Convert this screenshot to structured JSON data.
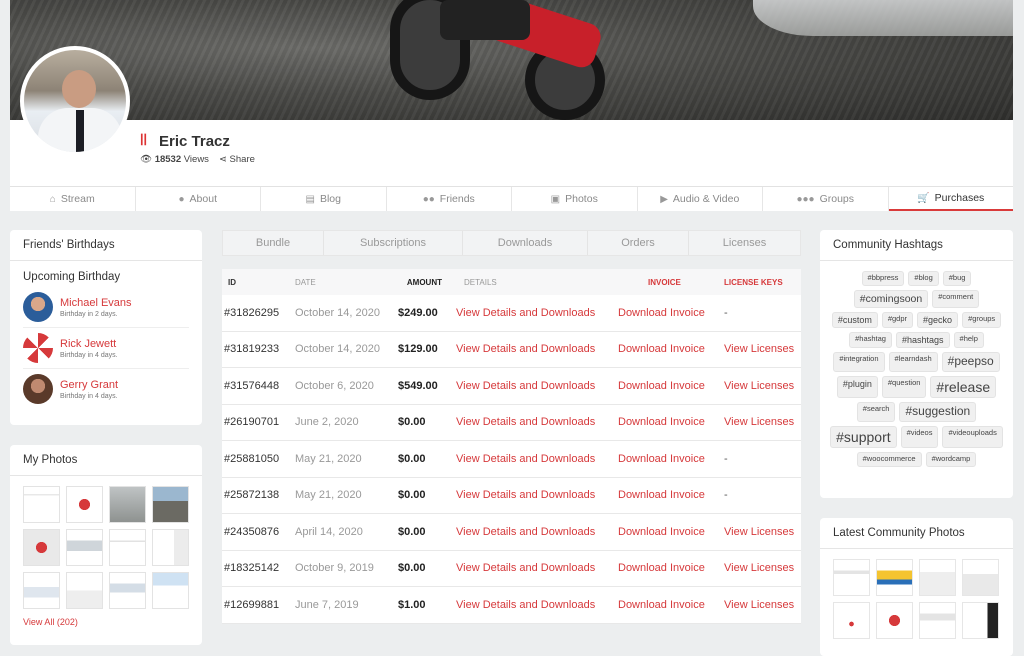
{
  "profile": {
    "name": "Eric Tracz",
    "views_count": "18532",
    "views_label": "Views",
    "share_label": "Share"
  },
  "tabs": [
    {
      "label": "Stream",
      "icon": "home-icon"
    },
    {
      "label": "About",
      "icon": "user-icon"
    },
    {
      "label": "Blog",
      "icon": "blog-icon"
    },
    {
      "label": "Friends",
      "icon": "users-icon"
    },
    {
      "label": "Photos",
      "icon": "camera-icon"
    },
    {
      "label": "Audio & Video",
      "icon": "video-icon"
    },
    {
      "label": "Groups",
      "icon": "groups-icon"
    },
    {
      "label": "Purchases",
      "icon": "cart-icon",
      "active": true
    }
  ],
  "birthdays": {
    "title": "Friends' Birthdays",
    "subtitle": "Upcoming Birthday",
    "items": [
      {
        "name": "Michael Evans",
        "when": "Birthday in 2 days."
      },
      {
        "name": "Rick Jewett",
        "when": "Birthday in 4 days."
      },
      {
        "name": "Gerry Grant",
        "when": "Birthday in 4 days."
      }
    ]
  },
  "photos": {
    "title": "My Photos",
    "view_all": "View All (202)"
  },
  "purchases": {
    "subtabs": [
      "Bundle",
      "Subscriptions",
      "Downloads",
      "Orders",
      "Licenses"
    ],
    "columns": [
      "ID",
      "DATE",
      "AMOUNT",
      "DETAILS",
      "INVOICE",
      "LICENSE KEYS"
    ],
    "rows": [
      {
        "id": "#31826295",
        "date": "October 14, 2020",
        "amount": "$249.00",
        "details": "View Details and Downloads",
        "invoice": "Download Invoice",
        "license": "-"
      },
      {
        "id": "#31819233",
        "date": "October 14, 2020",
        "amount": "$129.00",
        "details": "View Details and Downloads",
        "invoice": "Download Invoice",
        "license": "View Licenses"
      },
      {
        "id": "#31576448",
        "date": "October 6, 2020",
        "amount": "$549.00",
        "details": "View Details and Downloads",
        "invoice": "Download Invoice",
        "license": "View Licenses"
      },
      {
        "id": "#26190701",
        "date": "June 2, 2020",
        "amount": "$0.00",
        "details": "View Details and Downloads",
        "invoice": "Download Invoice",
        "license": "View Licenses"
      },
      {
        "id": "#25881050",
        "date": "May 21, 2020",
        "amount": "$0.00",
        "details": "View Details and Downloads",
        "invoice": "Download Invoice",
        "license": "-"
      },
      {
        "id": "#25872138",
        "date": "May 21, 2020",
        "amount": "$0.00",
        "details": "View Details and Downloads",
        "invoice": "Download Invoice",
        "license": "-"
      },
      {
        "id": "#24350876",
        "date": "April 14, 2020",
        "amount": "$0.00",
        "details": "View Details and Downloads",
        "invoice": "Download Invoice",
        "license": "View Licenses"
      },
      {
        "id": "#18325142",
        "date": "October 9, 2019",
        "amount": "$0.00",
        "details": "View Details and Downloads",
        "invoice": "Download Invoice",
        "license": "View Licenses"
      },
      {
        "id": "#12699881",
        "date": "June 7, 2019",
        "amount": "$1.00",
        "details": "View Details and Downloads",
        "invoice": "Download Invoice",
        "license": "View Licenses"
      }
    ]
  },
  "hashtags": {
    "title": "Community Hashtags",
    "tags": [
      {
        "text": "#bbpress",
        "size": "s"
      },
      {
        "text": "#blog",
        "size": "s"
      },
      {
        "text": "#bug",
        "size": "s"
      },
      {
        "text": "#comingsoon",
        "size": "m"
      },
      {
        "text": "#comment",
        "size": "s"
      },
      {
        "text": "#custom",
        "size": "s2"
      },
      {
        "text": "#gdpr",
        "size": "s"
      },
      {
        "text": "#gecko",
        "size": "s2"
      },
      {
        "text": "#groups",
        "size": "s"
      },
      {
        "text": "#hashtag",
        "size": "s"
      },
      {
        "text": "#hashtags",
        "size": "s2"
      },
      {
        "text": "#help",
        "size": "s"
      },
      {
        "text": "#integration",
        "size": "s"
      },
      {
        "text": "#learndash",
        "size": "s"
      },
      {
        "text": "#peepso",
        "size": "l"
      },
      {
        "text": "#plugin",
        "size": "s2"
      },
      {
        "text": "#question",
        "size": "s"
      },
      {
        "text": "#release",
        "size": "xl"
      },
      {
        "text": "#search",
        "size": "s"
      },
      {
        "text": "#suggestion",
        "size": "l"
      },
      {
        "text": "#support",
        "size": "xl"
      },
      {
        "text": "#videos",
        "size": "s"
      },
      {
        "text": "#videouploads",
        "size": "s"
      },
      {
        "text": "#woocommerce",
        "size": "s"
      },
      {
        "text": "#wordcamp",
        "size": "s"
      }
    ]
  },
  "latest_photos": {
    "title": "Latest Community Photos"
  },
  "colors": {
    "accent": "#d6393b",
    "background": "#eceeef"
  }
}
